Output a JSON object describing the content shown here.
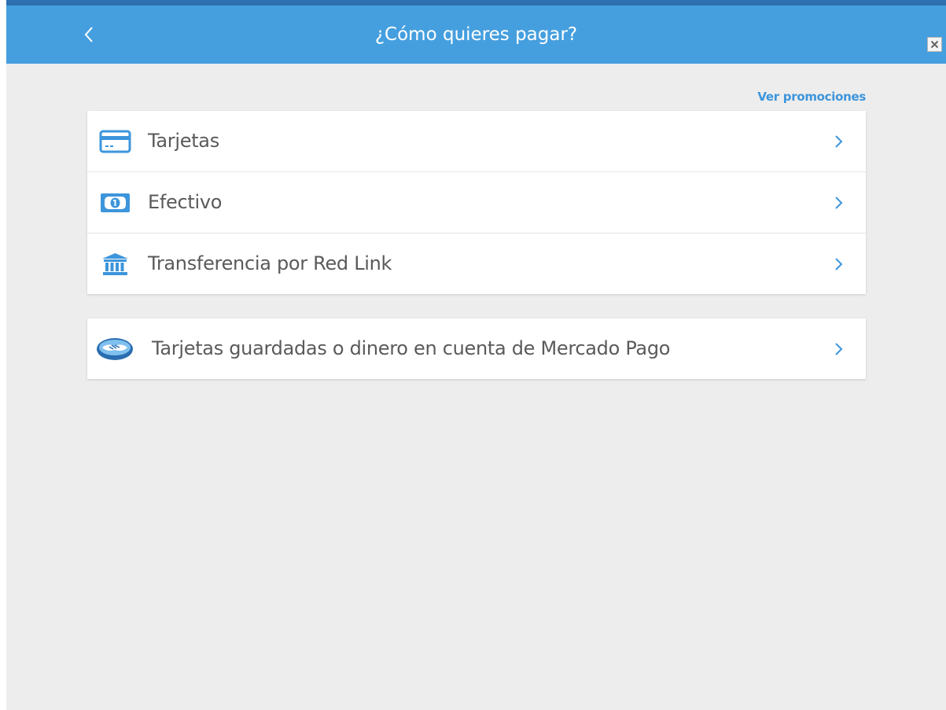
{
  "header": {
    "title": "¿Cómo quieres pagar?",
    "back_icon": "chevron-left-icon",
    "close_icon": "close-icon",
    "background": "#459fdf"
  },
  "promotions_link": "Ver promociones",
  "payment_methods": [
    {
      "label": "Tarjetas",
      "icon": "credit-card-icon"
    },
    {
      "label": "Efectivo",
      "icon": "cash-icon"
    },
    {
      "label": "Transferencia por Red Link",
      "icon": "bank-icon"
    }
  ],
  "saved_option": {
    "label": "Tarjetas guardadas o dinero en cuenta de Mercado Pago",
    "icon": "mercado-pago-handshake-icon"
  },
  "colors": {
    "accent": "#3d95db",
    "text": "#5a5a5a",
    "page_background": "#ededed"
  }
}
